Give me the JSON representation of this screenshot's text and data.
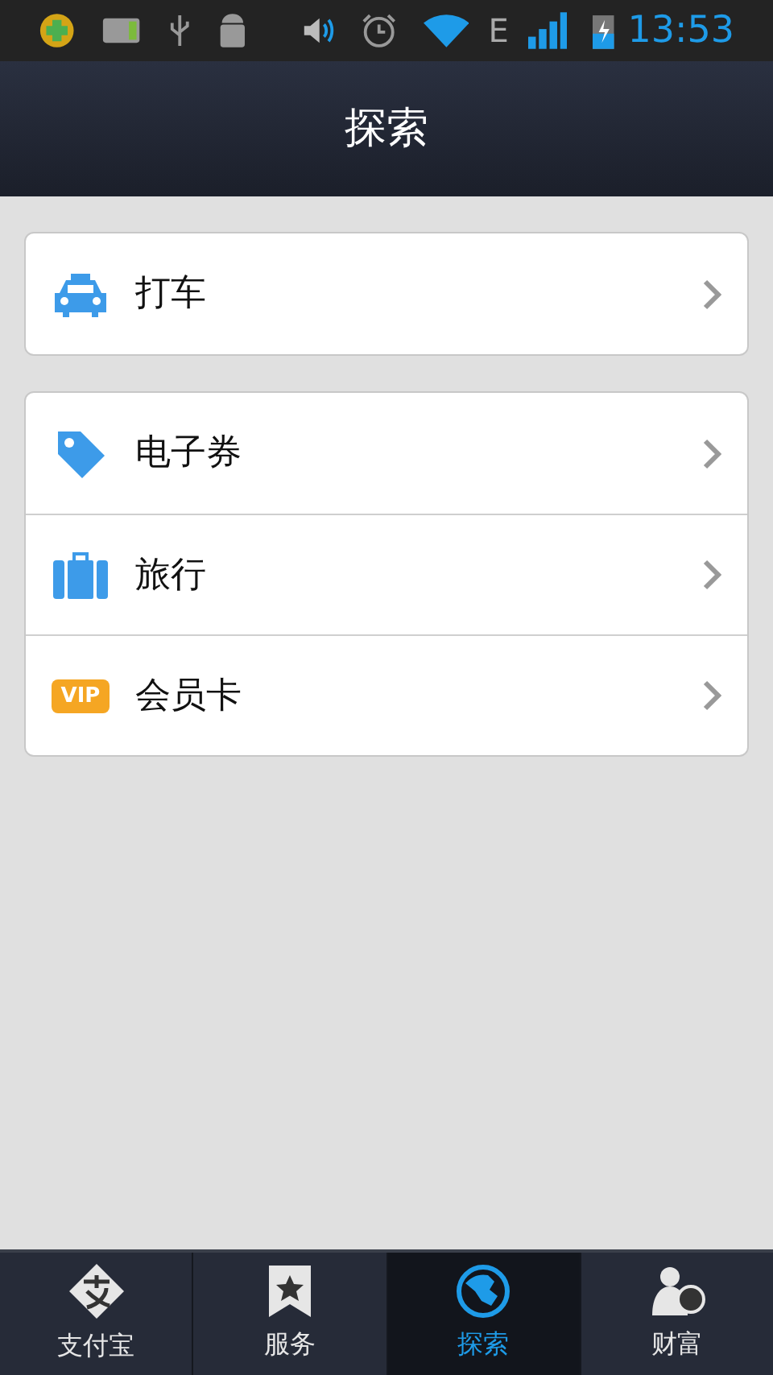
{
  "status_bar": {
    "network": "E",
    "time": "13:53"
  },
  "header": {
    "title": "探索"
  },
  "groups": [
    {
      "items": [
        {
          "kind": "taxi",
          "label": "打车"
        }
      ]
    },
    {
      "items": [
        {
          "kind": "coupon",
          "label": "电子券"
        },
        {
          "kind": "travel",
          "label": "旅行"
        },
        {
          "kind": "vip",
          "label": "会员卡",
          "badge": "VIP"
        }
      ]
    }
  ],
  "tabs": [
    {
      "kind": "alipay",
      "label": "支付宝",
      "selected": false
    },
    {
      "kind": "service",
      "label": "服务",
      "selected": false
    },
    {
      "kind": "explore",
      "label": "探索",
      "selected": true
    },
    {
      "kind": "wealth",
      "label": "财富",
      "selected": false
    }
  ]
}
